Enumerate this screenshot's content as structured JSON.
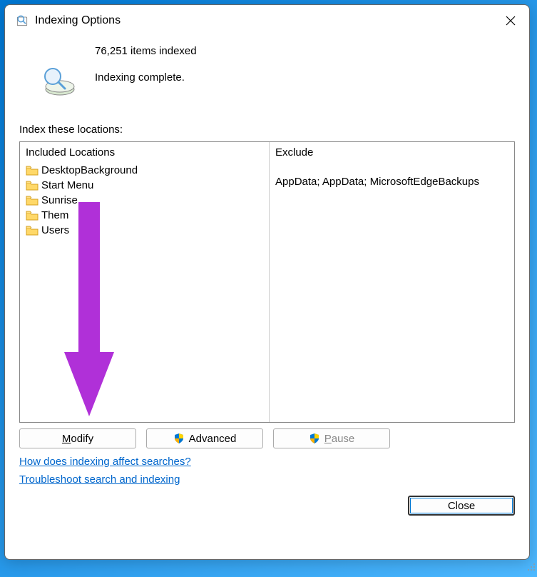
{
  "window": {
    "title": "Indexing Options"
  },
  "status": {
    "count_line": "76,251 items indexed",
    "state_line": "Indexing complete."
  },
  "section_label": "Index these locations:",
  "columns": {
    "included_header": "Included Locations",
    "exclude_header": "Exclude"
  },
  "included": [
    {
      "name": "DesktopBackground",
      "exclude": ""
    },
    {
      "name": "Start Menu",
      "exclude": ""
    },
    {
      "name": "Sunrise",
      "exclude": ""
    },
    {
      "name": "Them",
      "exclude": ""
    },
    {
      "name": "Users",
      "exclude": "AppData; AppData; MicrosoftEdgeBackups"
    }
  ],
  "buttons": {
    "modify": "Modify",
    "advanced": "Advanced",
    "pause": "Pause",
    "close": "Close"
  },
  "links": {
    "help": "How does indexing affect searches?",
    "troubleshoot": "Troubleshoot search and indexing"
  }
}
